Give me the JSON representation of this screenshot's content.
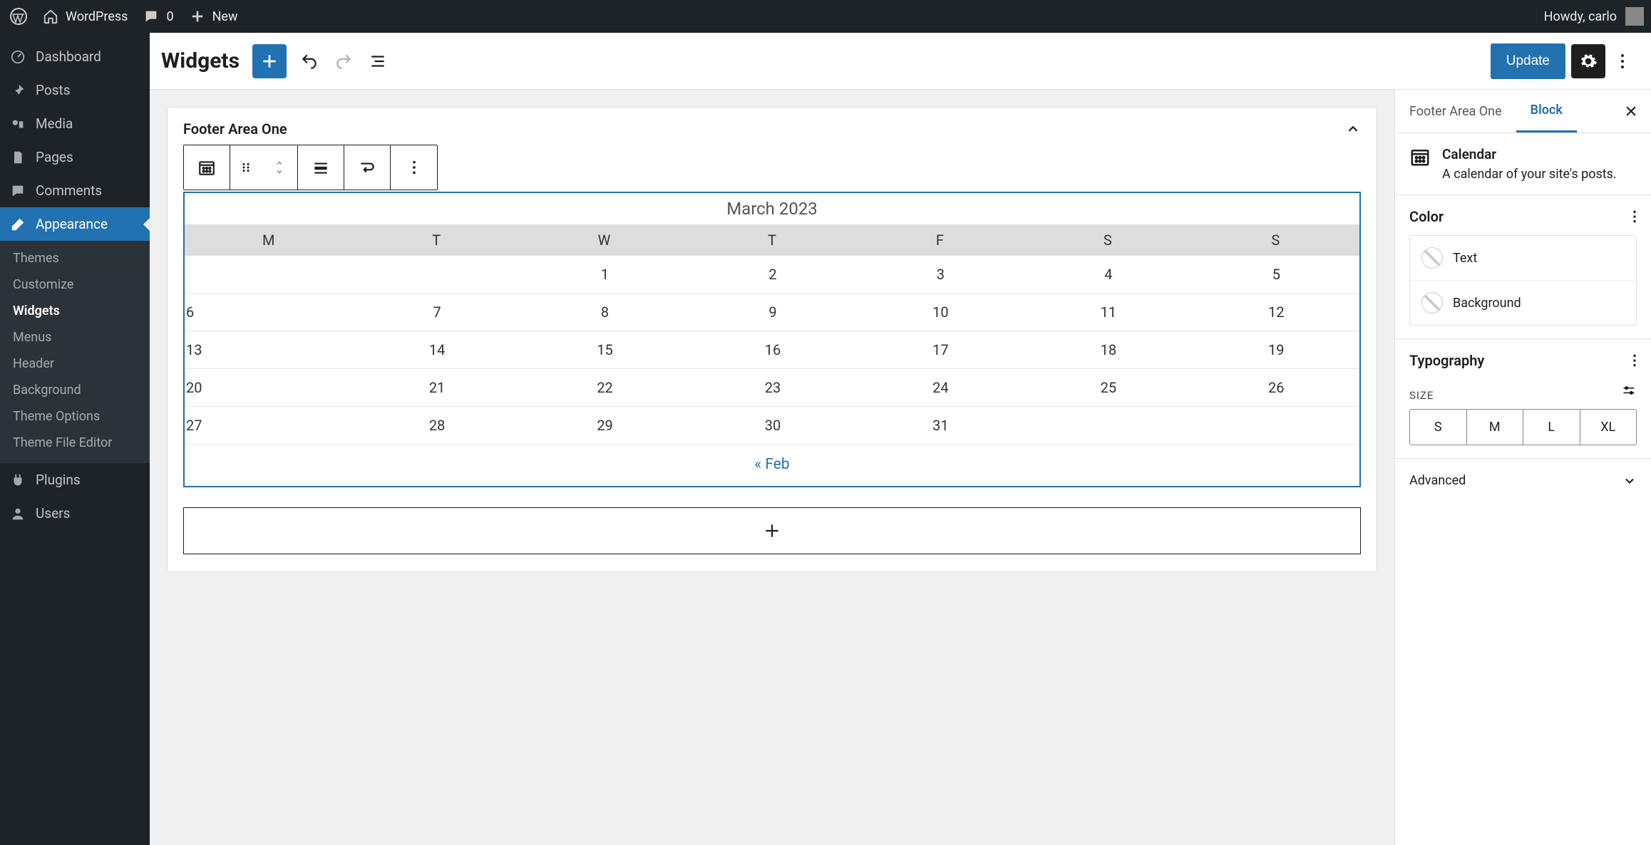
{
  "adminbar": {
    "site_name": "WordPress",
    "comment_count": "0",
    "new_label": "New",
    "howdy": "Howdy, carlo"
  },
  "sidebar": {
    "items": [
      {
        "label": "Dashboard"
      },
      {
        "label": "Posts"
      },
      {
        "label": "Media"
      },
      {
        "label": "Pages"
      },
      {
        "label": "Comments"
      },
      {
        "label": "Appearance"
      },
      {
        "label": "Plugins"
      },
      {
        "label": "Users"
      }
    ],
    "appearance_sub": [
      {
        "label": "Themes"
      },
      {
        "label": "Customize"
      },
      {
        "label": "Widgets"
      },
      {
        "label": "Menus"
      },
      {
        "label": "Header"
      },
      {
        "label": "Background"
      },
      {
        "label": "Theme Options"
      },
      {
        "label": "Theme File Editor"
      }
    ]
  },
  "topbar": {
    "title": "Widgets",
    "update_label": "Update"
  },
  "widget_area": {
    "title": "Footer Area One",
    "calendar": {
      "month": "March 2023",
      "days": [
        "M",
        "T",
        "W",
        "T",
        "F",
        "S",
        "S"
      ],
      "weeks": [
        [
          "",
          "",
          "1",
          "2",
          "3",
          "4",
          "5"
        ],
        [
          "6",
          "7",
          "8",
          "9",
          "10",
          "11",
          "12"
        ],
        [
          "13",
          "14",
          "15",
          "16",
          "17",
          "18",
          "19"
        ],
        [
          "20",
          "21",
          "22",
          "23",
          "24",
          "25",
          "26"
        ],
        [
          "27",
          "28",
          "29",
          "30",
          "31",
          "",
          ""
        ]
      ],
      "prev_link": "« Feb"
    }
  },
  "inspector": {
    "tab_area": "Footer Area One",
    "tab_block": "Block",
    "block_name": "Calendar",
    "block_desc": "A calendar of your site's posts.",
    "color_heading": "Color",
    "color_text": "Text",
    "color_bg": "Background",
    "typo_heading": "Typography",
    "size_label": "SIZE",
    "sizes": [
      "S",
      "M",
      "L",
      "XL"
    ],
    "advanced": "Advanced"
  }
}
